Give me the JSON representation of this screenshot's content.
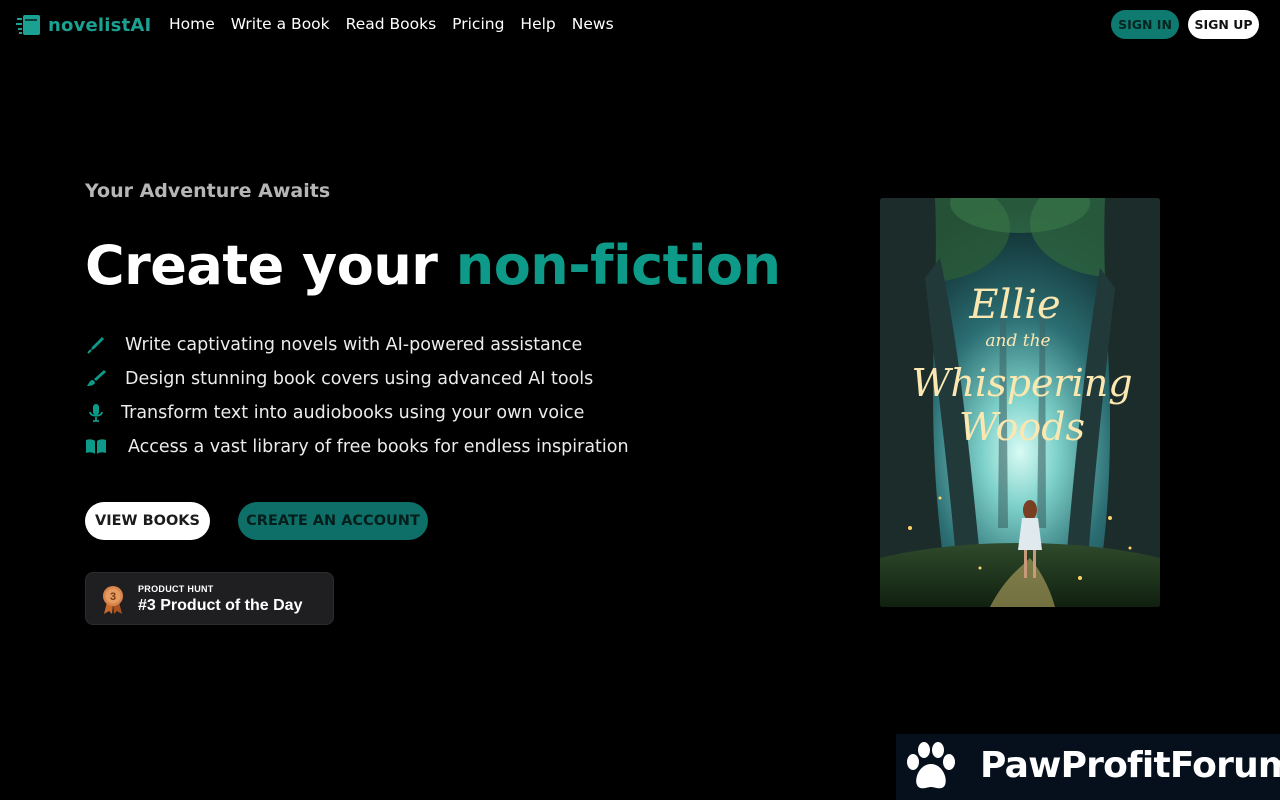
{
  "brand": {
    "name": "novelistAI"
  },
  "nav": {
    "links": [
      "Home",
      "Write a Book",
      "Read Books",
      "Pricing",
      "Help",
      "News"
    ],
    "sign_in": "SIGN IN",
    "sign_up": "SIGN UP"
  },
  "hero": {
    "tagline": "Your Adventure Awaits",
    "headline_prefix": "Create your",
    "headline_accent": "non-fiction",
    "features": [
      {
        "icon": "pen-icon",
        "text": "Write captivating novels with AI-powered assistance"
      },
      {
        "icon": "paintbrush-icon",
        "text": "Design stunning book covers using advanced AI tools"
      },
      {
        "icon": "microphone-icon",
        "text": "Transform text into audiobooks using your own voice"
      },
      {
        "icon": "book-open-icon",
        "text": "Access a vast library of free books for endless inspiration"
      }
    ],
    "view_books": "VIEW BOOKS",
    "create_account": "CREATE AN ACCOUNT"
  },
  "product_hunt": {
    "rank": "3",
    "label": "PRODUCT HUNT",
    "title": "#3 Product of the Day"
  },
  "cover": {
    "title_line1": "Ellie",
    "title_line2": "and the",
    "title_line3": "Whispering",
    "title_line4": "Woods"
  },
  "watermark": {
    "text": "PawProfitForum"
  },
  "colors": {
    "accent": "#0e9a88",
    "brand": "#1aa191",
    "background": "#000000",
    "sign_in_bg": "#0f7a70",
    "create_account_bg": "#0d6f67"
  }
}
